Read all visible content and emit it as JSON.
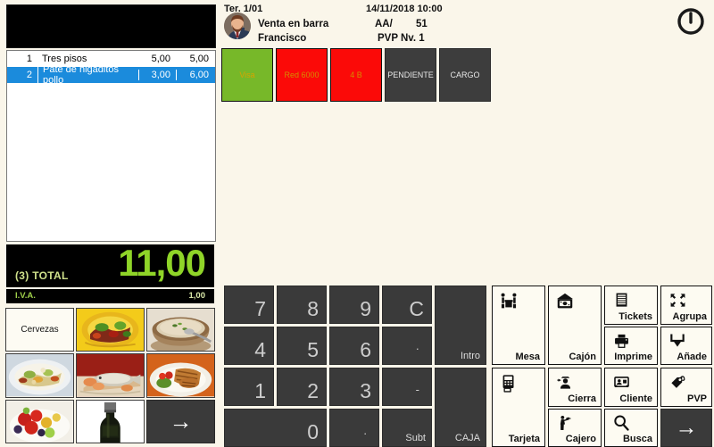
{
  "header": {
    "terminal": "Ter. 1/01",
    "datetime": "14/11/2018 10:00",
    "sale_type": "Venta en barra",
    "user": "Francisco",
    "series_label": "AA/",
    "series_number": "51",
    "pvp_level": "PVP Nv. 1",
    "avatar_icon": "user-avatar-icon",
    "power_icon": "power-icon"
  },
  "ticket": {
    "columns": [
      "qty",
      "description",
      "price",
      "amount"
    ],
    "rows": [
      {
        "qty": "1",
        "description": "Tres pisos",
        "price": "5,00",
        "amount": "5,00",
        "selected": false
      },
      {
        "qty": "2",
        "description": "Pate de higaditos pollo",
        "price": "3,00",
        "amount": "6,00",
        "selected": true
      }
    ],
    "total_label": "(3) TOTAL",
    "total_value": "11,00",
    "tax_label": "I.V.A.",
    "tax_value": "1,00"
  },
  "payment_buttons": [
    {
      "label": "Visa",
      "style": "green"
    },
    {
      "label": "Red 6000",
      "style": "red"
    },
    {
      "label": "4 B",
      "style": "red"
    },
    {
      "label": "PENDIENTE",
      "style": "grey"
    },
    {
      "label": "CARGO",
      "style": "grey"
    }
  ],
  "products": [
    {
      "label": "Cervezas",
      "kind": "text"
    },
    {
      "label": "",
      "kind": "photo",
      "photo": "salad-plate"
    },
    {
      "label": "",
      "kind": "photo",
      "photo": "soup-bowl"
    },
    {
      "label": "",
      "kind": "photo",
      "photo": "mixed-salad"
    },
    {
      "label": "",
      "kind": "photo",
      "photo": "fish-dish"
    },
    {
      "label": "",
      "kind": "photo",
      "photo": "grilled-meat"
    },
    {
      "label": "",
      "kind": "photo",
      "photo": "fruit-dessert"
    },
    {
      "label": "",
      "kind": "photo",
      "photo": "wine-bottle"
    },
    {
      "label": "→",
      "kind": "arrow"
    }
  ],
  "numpad": [
    {
      "label": "7",
      "type": "digit"
    },
    {
      "label": "8",
      "type": "digit"
    },
    {
      "label": "9",
      "type": "digit"
    },
    {
      "label": "C",
      "type": "digit"
    },
    {
      "label": "4",
      "type": "digit"
    },
    {
      "label": "5",
      "type": "digit"
    },
    {
      "label": "6",
      "type": "digit"
    },
    {
      "label": "·",
      "type": "dot"
    },
    {
      "label": "1",
      "type": "digit"
    },
    {
      "label": "2",
      "type": "digit"
    },
    {
      "label": "3",
      "type": "digit"
    },
    {
      "label": "-",
      "type": "dot"
    },
    {
      "label": "0",
      "type": "digit"
    },
    {
      "label": ".",
      "type": "dot"
    },
    {
      "label": "Subt",
      "type": "text"
    },
    {
      "label": "Intro",
      "type": "text"
    },
    {
      "label": "CAJA",
      "type": "text"
    }
  ],
  "functions": [
    {
      "label": "Mesa",
      "icon": "table-guests-icon"
    },
    {
      "label": "Cajón",
      "icon": "cash-drawer-icon"
    },
    {
      "label": "Tickets",
      "icon": "receipt-icon"
    },
    {
      "label": "Agrupa",
      "icon": "group-arrows-icon"
    },
    {
      "label": "Imprime",
      "icon": "printer-icon"
    },
    {
      "label": "Añade",
      "icon": "add-down-arrow-icon"
    },
    {
      "label": "Tarjeta",
      "icon": "card-terminal-icon"
    },
    {
      "label": "Cierra",
      "icon": "close-cashier-icon"
    },
    {
      "label": "Cliente",
      "icon": "customer-card-icon"
    },
    {
      "label": "PVP",
      "icon": "price-tag-icon"
    },
    {
      "label": "Cajero",
      "icon": "waiter-icon"
    },
    {
      "label": "Busca",
      "icon": "magnifier-icon"
    },
    {
      "label": "→",
      "icon": "next-arrow-icon"
    }
  ],
  "colors": {
    "background": "#faf6ea",
    "accent_green": "#8fd428",
    "selection_blue": "#1b8bdc",
    "pay_green": "#77b829",
    "pay_red": "#fb0a08",
    "dark_key": "#3a3a3a"
  }
}
